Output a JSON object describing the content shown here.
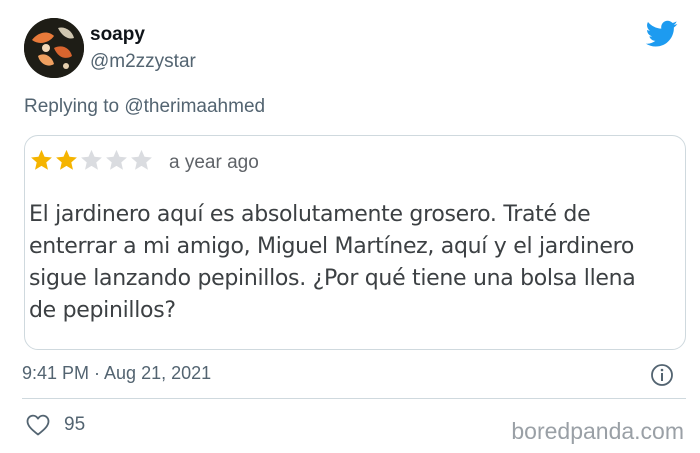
{
  "author": {
    "display_name": "soapy",
    "handle": "@m2zzystar"
  },
  "reply": {
    "prefix": "Replying to",
    "mention": "@therimaahmed"
  },
  "review": {
    "rating": 2,
    "max_rating": 5,
    "age": "a year ago",
    "text": "El jardinero aquí es absolutamente grosero. Traté de enterrar a mi amigo, Miguel Martínez, aquí y el jardinero sigue lanzando pepinillos. ¿Por qué tiene una bolsa llena de pepinillos?"
  },
  "meta": {
    "timestamp": "9:41 PM · Aug 21, 2021"
  },
  "actions": {
    "like_count": "95"
  },
  "watermark": "boredpanda.com",
  "icons": {
    "brand": "twitter-bird-icon",
    "info": "info-icon",
    "like": "heart-outline-icon"
  },
  "colors": {
    "twitter_blue": "#1d9bf0",
    "star_filled": "#f5b400",
    "star_empty": "#dadce0",
    "muted_text": "#536471",
    "border": "#cfd9de"
  }
}
